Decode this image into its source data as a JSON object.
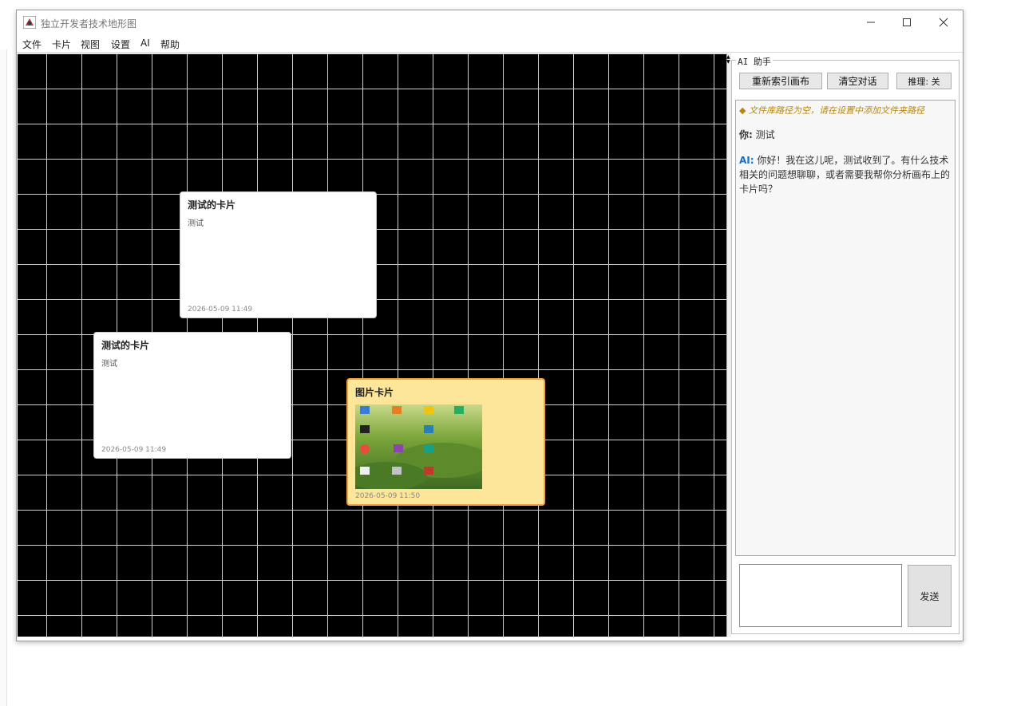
{
  "window": {
    "title": "独立开发者技术地形图"
  },
  "menu": [
    "文件",
    "卡片",
    "视图",
    "设置",
    "AI",
    "帮助"
  ],
  "cards": [
    {
      "title": "测试的卡片",
      "body": "测试",
      "time": "2026-05-09 11:49"
    },
    {
      "title": "测试的卡片",
      "body": "测试",
      "time": "2026-05-09 11:49"
    },
    {
      "title": "图片卡片",
      "time": "2026-05-09 11:50",
      "selected": true
    }
  ],
  "ai_panel": {
    "legend": "AI 助手",
    "reindex_label": "重新索引画布",
    "clear_label": "清空对话",
    "reasoning_label": "推理: 关",
    "system_message": "◆ 文件库路径为空，请在设置中添加文件夹路径",
    "you_label": "你:",
    "you_text": "测试",
    "ai_label": "AI:",
    "ai_text": "你好！我在这儿呢，测试收到了。有什么技术相关的问题想聊聊，或者需要我帮你分析画布上的卡片吗？",
    "send_label": "发送"
  },
  "colors": {
    "canvas_bg": "#000000",
    "grid_line": "#d0d0d0",
    "selected_card": "#fde59a",
    "selected_border": "#f0a040",
    "ai_label": "#1a6fc0",
    "system_message": "#b8860b"
  }
}
